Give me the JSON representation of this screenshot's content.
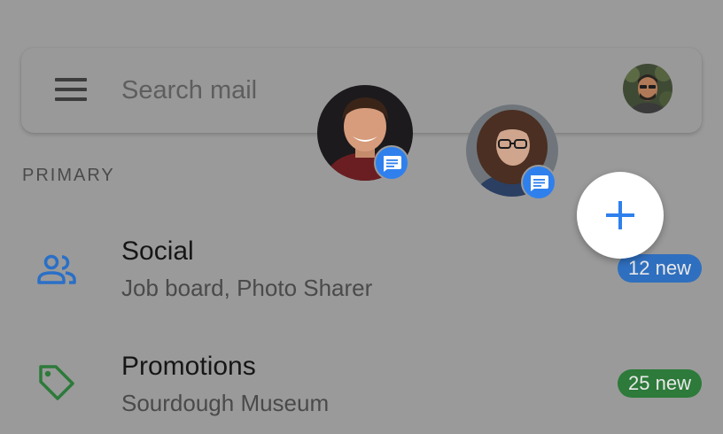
{
  "search": {
    "placeholder": "Search mail",
    "menu_icon": "hamburger-menu-icon",
    "account_icon": "account-avatar"
  },
  "section": {
    "label": "PRIMARY"
  },
  "categories": [
    {
      "title": "Social",
      "subtitle": "Job board, Photo Sharer",
      "badge": "12 new",
      "icon": "people-icon",
      "color": "#2a6fc7"
    },
    {
      "title": "Promotions",
      "subtitle": "Sourdough Museum",
      "badge": "25 new",
      "icon": "tag-icon",
      "color": "#2d7a3a"
    }
  ],
  "chat_heads": [
    {
      "name": "chat-head-1",
      "icon": "message-icon"
    },
    {
      "name": "chat-head-2",
      "icon": "message-icon"
    }
  ],
  "compose": {
    "icon": "plus-icon",
    "color": "#2f80ed"
  },
  "colors": {
    "background": "#9a9a9a",
    "social_accent": "#2a6fc7",
    "promotions_accent": "#2d7a3a",
    "badge_blue": "#2f80ed"
  }
}
